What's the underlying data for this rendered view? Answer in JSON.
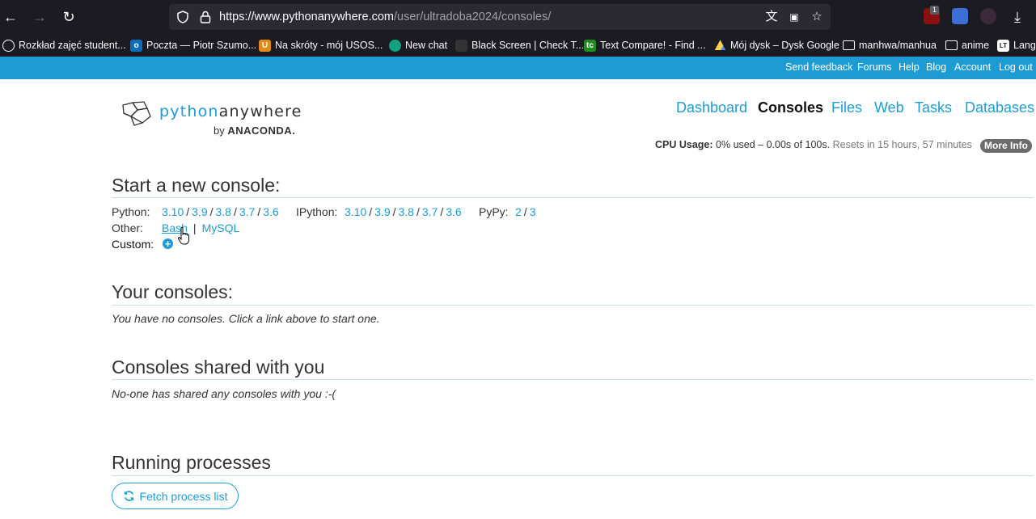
{
  "browser": {
    "url_host": "https://www.pythonanywhere.com",
    "url_path": "/user/ultradoba2024/consoles/",
    "extension_badge": "1",
    "bookmarks": [
      {
        "label": "Rozkład zajęć student..."
      },
      {
        "label": "Poczta — Piotr Szumo..."
      },
      {
        "label": "Na skróty - mój USOS..."
      },
      {
        "label": "New chat"
      },
      {
        "label": "Black Screen | Check T..."
      },
      {
        "label": "Text Compare! - Find ..."
      },
      {
        "label": "Mój dysk – Dysk Google"
      },
      {
        "label": "manhwa/manhua"
      },
      {
        "label": "anime"
      },
      {
        "label": "Langu"
      }
    ]
  },
  "topbar": {
    "send_feedback": "Send feedback",
    "forums": "Forums",
    "help": "Help",
    "blog": "Blog",
    "account": "Account",
    "logout": "Log out"
  },
  "logo": {
    "python": "python",
    "anywhere": "anywhere",
    "by": "by",
    "anaconda": "ANACONDA."
  },
  "nav": {
    "dashboard": "Dashboard",
    "consoles": "Consoles",
    "files": "Files",
    "web": "Web",
    "tasks": "Tasks",
    "databases": "Databases"
  },
  "cpu": {
    "label": "CPU Usage:",
    "value": "0% used – 0.00s of 100s.",
    "reset": "Resets in 15 hours, 57 minutes",
    "more_info": "More Info"
  },
  "new_console": {
    "heading": "Start a new console:",
    "python_label": "Python:",
    "python_versions": [
      "3.10",
      "3.9",
      "3.8",
      "3.7",
      "3.6"
    ],
    "ipython_label": "IPython:",
    "ipython_versions": [
      "3.10",
      "3.9",
      "3.8",
      "3.7",
      "3.6"
    ],
    "pypy_label": "PyPy:",
    "pypy_versions": [
      "2",
      "3"
    ],
    "other_label": "Other:",
    "bash": "Bash",
    "other_sep": "|",
    "mysql": "MySQL",
    "custom_label": "Custom:"
  },
  "your_consoles": {
    "heading": "Your consoles:",
    "empty": "You have no consoles. Click a link above to start one."
  },
  "shared": {
    "heading": "Consoles shared with you",
    "empty": "No-one has shared any consoles with you :-("
  },
  "processes": {
    "heading": "Running processes",
    "fetch_button": "Fetch process list"
  },
  "colors": {
    "brand": "#1d9cd3",
    "chrome": "#1c1b22"
  }
}
